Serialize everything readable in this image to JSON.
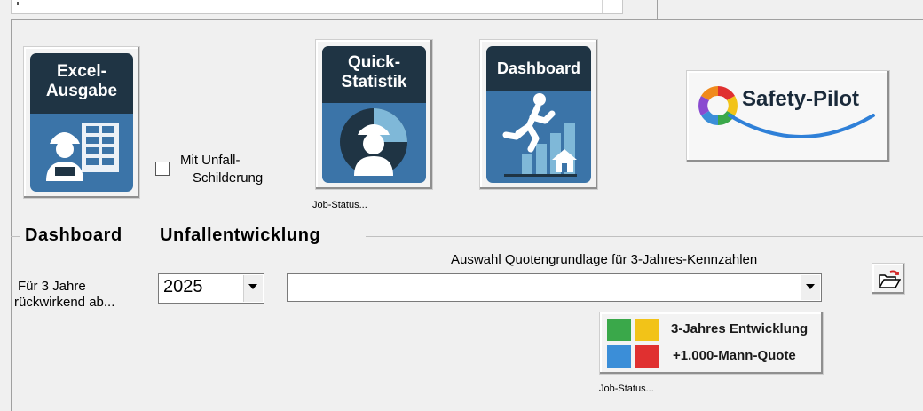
{
  "tiles": {
    "excel": {
      "line1": "Excel-",
      "line2": "Ausgabe"
    },
    "quick": {
      "line1": "Quick-",
      "line2": "Statistik"
    },
    "dashboard": {
      "label": "Dashboard"
    }
  },
  "checkbox_unfall": {
    "line1": "Mit Unfall-",
    "line2": "Schilderung"
  },
  "job_status": "Job-Status...",
  "safety_pilot": {
    "label": "Safety-Pilot"
  },
  "group": {
    "dashboard_label": "Dashboard",
    "title": "Unfallentwicklung"
  },
  "rueckwirkend": {
    "line1": "Für 3 Jahre",
    "line2": "rückwirkend ab..."
  },
  "year_select": {
    "value": "2025"
  },
  "quote_label": "Auswahl Quotengrundlage für 3-Jahres-Kennzahlen",
  "quote_select": {
    "value": ""
  },
  "entwicklung_button": {
    "line1": "3-Jahres Entwicklung",
    "line2": "+1.000-Mann-Quote"
  },
  "colors": {
    "tile_head": "#1f3444",
    "tile_body": "#3b74a8",
    "green": "#3aa84a",
    "yellow": "#f2c318",
    "blue": "#3b8ed8",
    "red": "#e03030"
  },
  "icons": [
    "worker-spreadsheet-icon",
    "worker-pie-chart-icon",
    "running-person-stairs-icon",
    "gear-logo-icon",
    "open-folder-icon",
    "four-color-grid-icon"
  ]
}
